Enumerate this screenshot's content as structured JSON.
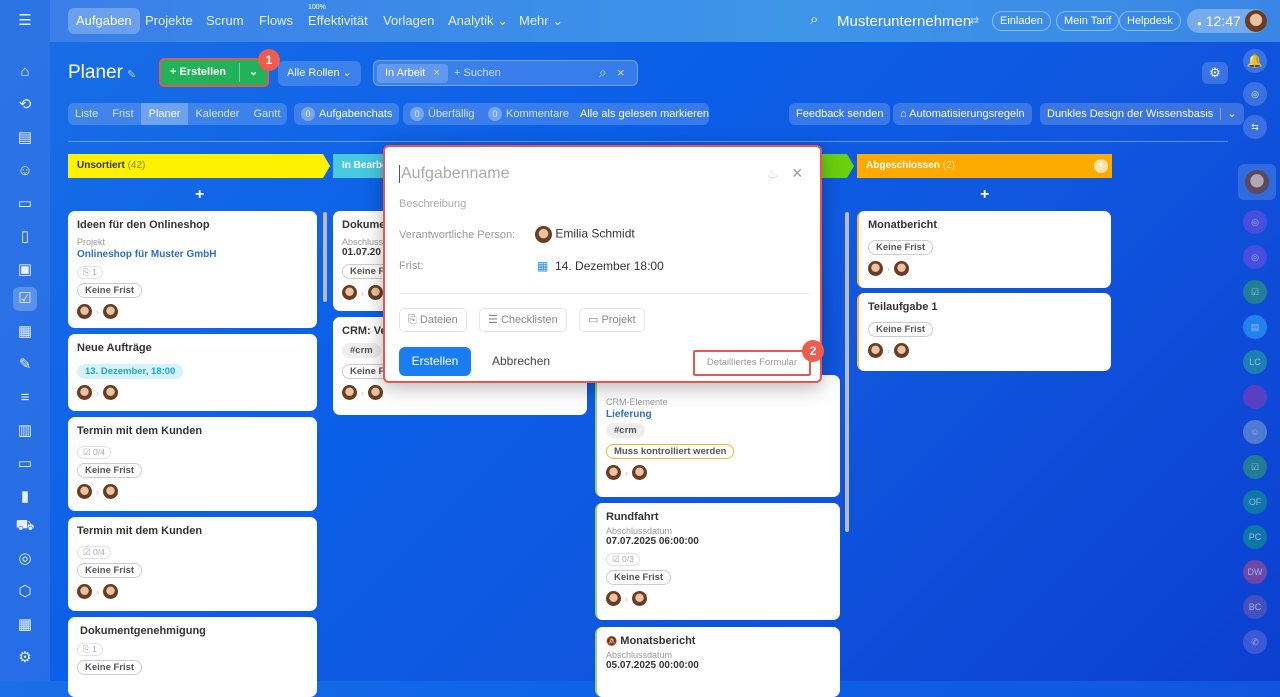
{
  "topnav": {
    "items": [
      "Aufgaben",
      "Projekte",
      "Scrum",
      "Flows",
      "Effektivität",
      "Vorlagen",
      "Analytik",
      "Mehr"
    ],
    "effectivity_badge": "100%",
    "company": "Musterunternehmen",
    "invite": "Einladen",
    "tariff": "Mein Tarif",
    "helpdesk": "Helpdesk",
    "time": "12:47"
  },
  "toolbar": {
    "title": "Planer",
    "create": "Erstellen",
    "roles": "Alle Rollen",
    "filter_chip": "In Arbeit",
    "search_placeholder": "+ Suchen"
  },
  "views": [
    "Liste",
    "Frist",
    "Planer",
    "Kalender",
    "Gantt"
  ],
  "counters": {
    "chats_count": "0",
    "chats": "Aufgabenchats",
    "overdue_count": "0",
    "overdue": "Überfällig",
    "comments_count": "0",
    "comments": "Kommentare",
    "mark_read": "Alle als gelesen markieren"
  },
  "actions": {
    "feedback": "Feedback senden",
    "automation": "Automatisierungsregeln",
    "design": "Dunkles Design der Wissensbasis"
  },
  "columns": [
    {
      "title": "Unsortiert",
      "count": "(42)",
      "color": "#fff200"
    },
    {
      "title": "In Bearbe",
      "color": "#47c9e0"
    },
    {
      "title": "",
      "color": "#6bd10f"
    },
    {
      "title": "Abgeschlossen",
      "count": "(2)",
      "color": "#ffaa00"
    }
  ],
  "col1": [
    {
      "title": "Ideen für den Onlineshop",
      "label": "Projekt",
      "link": "Onlineshop für Muster GmbH",
      "files": "1",
      "deadline": "Keine Frist"
    },
    {
      "title": "Neue Aufträge",
      "deadline": "13. Dezember, 18:00"
    },
    {
      "title": "Termin mit dem Kunden",
      "checklist": "0/4",
      "deadline": "Keine Frist"
    },
    {
      "title": "Termin mit dem Kunden",
      "checklist": "0/4",
      "deadline": "Keine Frist"
    },
    {
      "title": "Dokumentgenehmigung",
      "files": "1",
      "deadline": "Keine Frist"
    }
  ],
  "col2": [
    {
      "title": "Dokume",
      "label": "Abschluss",
      "date": "01.07.20",
      "deadline": "Keine F"
    },
    {
      "title": "CRM: Ve",
      "tag": "#crm",
      "deadline": "Keine F"
    }
  ],
  "col3": [
    {
      "label": "CRM-Elemente",
      "link": "Lieferung",
      "tag": "#crm",
      "status": "Muss kontrolliert werden"
    },
    {
      "title": "Rundfahrt",
      "label": "Abschlussdatum",
      "date": "07.07.2025 06:00:00",
      "checklist": "0/3",
      "deadline": "Keine Frist"
    },
    {
      "title": "Monatsbericht",
      "label": "Abschlussdatum",
      "date": "05.07.2025 00:00:00"
    }
  ],
  "col4": [
    {
      "title": "Monatbericht",
      "deadline": "Keine Frist"
    },
    {
      "title": "Teilaufgabe 1",
      "deadline": "Keine Frist"
    }
  ],
  "popup": {
    "name_placeholder": "Aufgabenname",
    "desc_placeholder": "Beschreibung",
    "responsible_label": "Verantwortliche Person:",
    "responsible": "Emilia Schmidt",
    "deadline_label": "Frist:",
    "deadline": "14. Dezember 18:00",
    "files": "Dateien",
    "checklists": "Checklisten",
    "project": "Projekt",
    "create": "Erstellen",
    "cancel": "Abbrechen",
    "detailed": "Detailliertes Formular"
  },
  "rightbar": [
    "LC",
    "OF",
    "PC",
    "DW",
    "BC"
  ],
  "badges": [
    "1",
    "2"
  ]
}
